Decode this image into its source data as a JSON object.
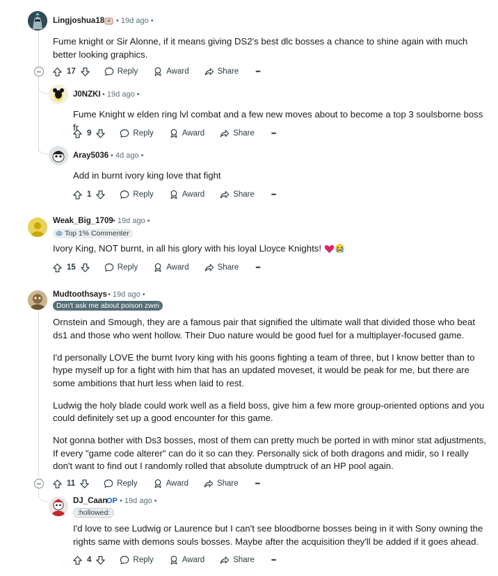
{
  "action_labels": {
    "reply": "Reply",
    "award": "Award",
    "share": "Share",
    "more": "•••"
  },
  "comments": [
    {
      "author": "Lingjoshua18",
      "time": "19d ago",
      "body": [
        "Fume knight or Sir Alonne, if it means giving DS2's best dlc bosses a chance to shine again with much better looking graphics."
      ],
      "votes": "17"
    },
    {
      "author": "J0NZKI",
      "time": "19d ago",
      "body": [
        "Fume Knight w elden ring lvl combat and a few new moves about to become a top 3 soulsborne boss fr"
      ],
      "votes": "9"
    },
    {
      "author": "Aray5036",
      "time": "4d ago",
      "body": [
        "Add in burnt ivory king love that fight"
      ],
      "votes": "1"
    },
    {
      "author": "Weak_Big_1709",
      "time": "19d ago",
      "flair": "Top 1% Commenter",
      "body": [
        "Ivory King, NOT burnt, in all his glory with his loyal Lloyce Knights!"
      ],
      "votes": "15"
    },
    {
      "author": "Mudtoothsays",
      "time": "19d ago",
      "flair": "Don't ask me about poison zwei",
      "body": [
        "Ornstein and Smough, they are a famous pair that signified the ultimate wall that divided those who beat ds1 and those who went hollow. Their Duo nature would be good fuel for a multiplayer-focused game.",
        "I'd personally LOVE the burnt Ivory king with his goons fighting a team of three, but I know better than to hype myself up for a fight with him that has an updated moveset, it would be peak for me, but there are some ambitions that hurt less when laid to rest.",
        "Ludwig the holy blade could work well as a field boss, give him a few more group-oriented options and you could definitely set up a good encounter for this game.",
        "Not gonna bother with Ds3 bosses, most of them can pretty much be ported in with minor stat adjustments, If every \"game code alterer\" can do it so can they. Personally sick of both dragons and midir, so I really don't want to find out I randomly rolled that absolute dumptruck of an HP pool again."
      ],
      "votes": "11"
    },
    {
      "author": "DJ_Caan",
      "op_badge": "OP",
      "time": "19d ago",
      "flair": ":hollowed:",
      "body": [
        "I'd love to see Ludwig or Laurence but I can't see bloodborne bosses being in it with Sony owning the rights same with demons souls bosses. Maybe after the acquisition they'll be added if it goes ahead."
      ],
      "votes": "4"
    }
  ],
  "colors": {
    "meta": "#576f76",
    "thread": "#dcdfe1",
    "op": "#0a66c2",
    "flair_dark": "#576f76",
    "flair_light": "#eaedef"
  }
}
